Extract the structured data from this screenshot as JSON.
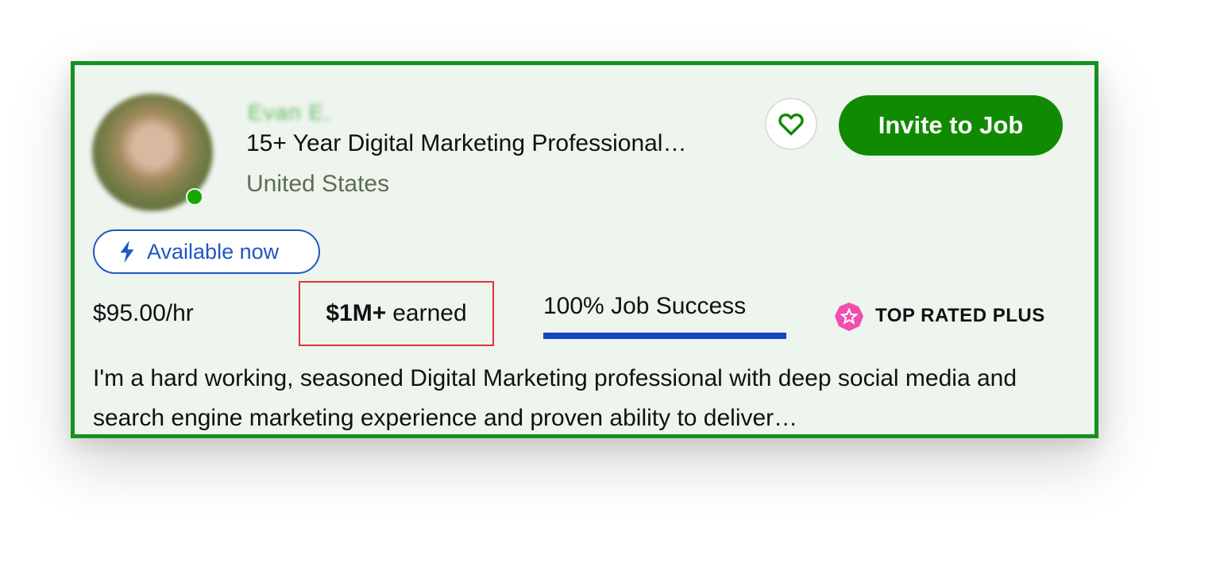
{
  "freelancer": {
    "name": "Evan E.",
    "title": "15+ Year Digital Marketing Professional…",
    "location": "United States"
  },
  "actions": {
    "favorite_icon": "heart-icon",
    "invite_label": "Invite to Job"
  },
  "availability": {
    "icon": "lightning-icon",
    "label": "Available now"
  },
  "stats": {
    "rate": "$95.00/hr",
    "earned_amount": "$1M+",
    "earned_suffix": "earned",
    "job_success_label": "100% Job Success",
    "job_success_percent": 100,
    "badge_icon": "top-rated-plus-badge-icon",
    "badge_label": "TOP RATED PLUS"
  },
  "description": "I'm a hard working, seasoned Digital Marketing professional with deep social media and search engine marketing experience and proven ability to deliver…",
  "colors": {
    "card_border": "#14911f",
    "card_background": "#eef4ee",
    "invite_button": "#108a00",
    "available_accent": "#1f57c3",
    "job_success_bar": "#1446c2",
    "highlight_box": "#e0353b",
    "badge": "#f04fb0"
  }
}
